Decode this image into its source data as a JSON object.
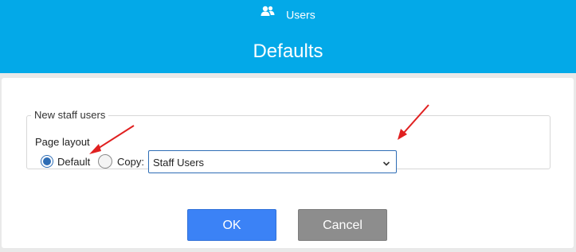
{
  "header": {
    "breadcrumb": {
      "icon": "users-icon",
      "label": "Users"
    },
    "title": "Defaults",
    "bg_color": "#03a9e8"
  },
  "form": {
    "group_legend": "New staff users",
    "page_layout_label": "Page layout",
    "options": [
      {
        "label": "Default",
        "selected": true
      },
      {
        "label": "Copy:",
        "selected": false
      }
    ],
    "copy_select": {
      "value": "Staff Users",
      "icon": "chevron-down-icon"
    }
  },
  "buttons": {
    "ok_label": "OK",
    "cancel_label": "Cancel",
    "ok_color": "#3b82f6",
    "cancel_color": "#8d8d8d"
  },
  "annotations": {
    "arrow_color": "#e02020"
  }
}
